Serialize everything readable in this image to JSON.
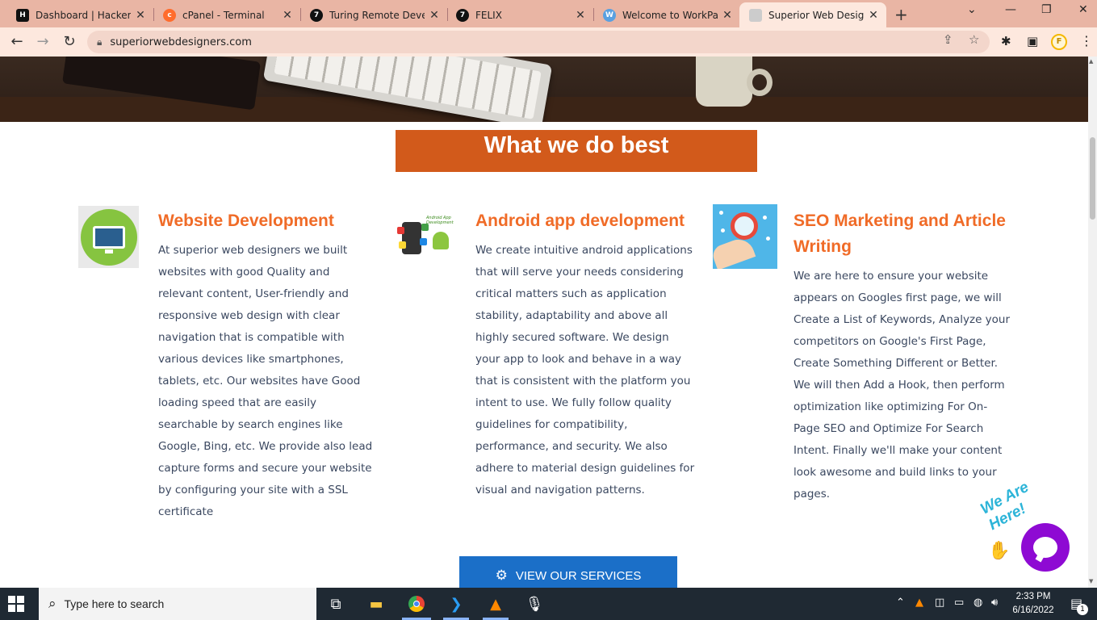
{
  "browser": {
    "tabs": [
      {
        "title": "Dashboard | HackerRa",
        "icon": "hackerrank-icon",
        "color": "#111111"
      },
      {
        "title": "cPanel - Terminal",
        "icon": "cpanel-icon",
        "color": "#ff6c2c"
      },
      {
        "title": "Turing Remote Develo",
        "icon": "turing-icon",
        "color": "#111111"
      },
      {
        "title": "FELIX",
        "icon": "turing-icon",
        "color": "#111111"
      },
      {
        "title": "Welcome to WorkPar",
        "icon": "workpar-icon",
        "color": "#5aa0e0"
      },
      {
        "title": "Superior Web Designe",
        "icon": "site-icon",
        "color": "#cccccc",
        "active": true
      }
    ],
    "new_tab": "+",
    "url": "superiorwebdesigners.com",
    "profile_initial": "F"
  },
  "page": {
    "section_title": "What we do best",
    "cards": [
      {
        "title": "Website Development",
        "body": "At superior web designers we built websites with good Quality and relevant content, User-friendly and responsive web design with clear navigation that is compatible with various devices like smartphones, tablets, etc. Our websites have Good loading speed that are easily searchable by search engines like Google, Bing, etc. We provide also lead capture forms and secure your website by configuring your site with a SSL certificate"
      },
      {
        "title": "Android app development",
        "image_caption": "Android App Development",
        "body": "We create intuitive android applications that will serve your needs considering critical matters such as application stability, adaptability and above all highly secured software. We design your app to look and behave in a way that is consistent with the platform you intent to use. We fully follow quality guidelines for compatibility, performance, and security. We also adhere to material design guidelines for visual and navigation patterns."
      },
      {
        "title": "SEO Marketing and Article Writing",
        "body": "We are here to ensure your website appears on Googles first page, we will Create a List of Keywords, Analyze your competitors on Google's First Page, Create Something Different or Better. We will then Add a Hook, then perform optimization like optimizing For On-Page SEO and Optimize For Search Intent. Finally we'll make your content look awesome and build links to your pages."
      }
    ],
    "services_button": "VIEW OUR SERVICES",
    "chat_badge": "We Are Here!"
  },
  "taskbar": {
    "search_placeholder": "Type here to search",
    "time": "2:33 PM",
    "date": "6/16/2022",
    "notification_count": "1"
  },
  "colors": {
    "accent_orange": "#d25a1b",
    "title_orange": "#f06b27",
    "button_blue": "#1b6fc8",
    "chat_purple": "#8e0ad3",
    "tab_strip": "#e9b5a4"
  }
}
